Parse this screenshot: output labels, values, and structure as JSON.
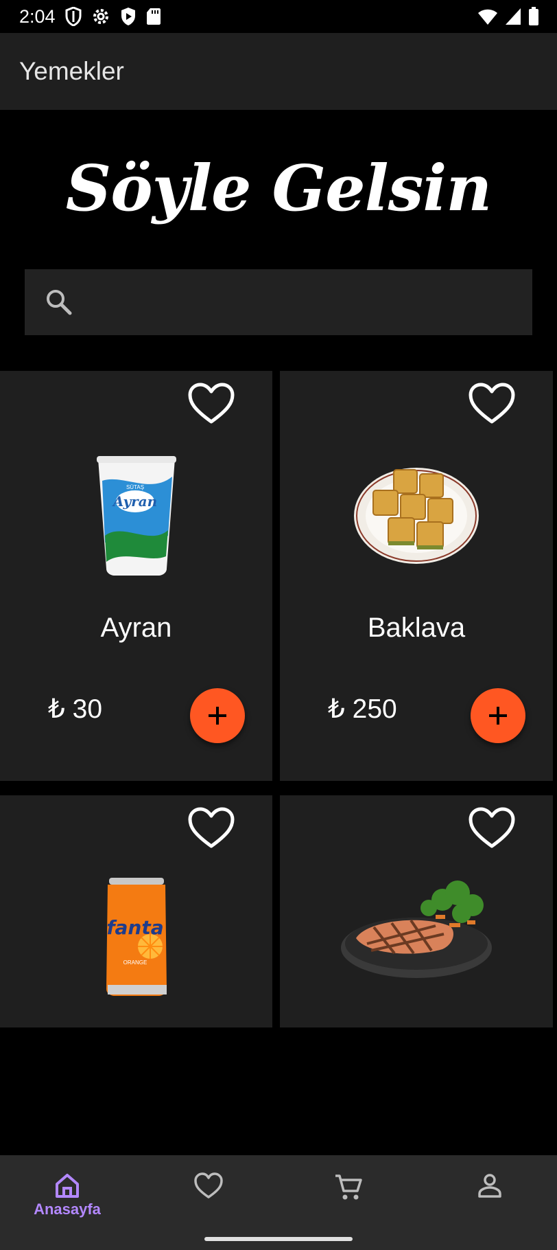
{
  "status_bar": {
    "time": "2:04"
  },
  "app_bar": {
    "title": "Yemekler"
  },
  "brand": {
    "title": "Söyle Gelsin"
  },
  "search": {
    "placeholder": ""
  },
  "products": [
    {
      "name": "Ayran",
      "price": "₺ 30",
      "image": "ayran-cup"
    },
    {
      "name": "Baklava",
      "price": "₺ 250",
      "image": "baklava-plate"
    },
    {
      "name": "",
      "price": "",
      "image": "fanta-can"
    },
    {
      "name": "",
      "price": "",
      "image": "salmon-plate"
    }
  ],
  "bottom_nav": {
    "items": [
      {
        "label": "Anasayfa",
        "icon": "home-icon",
        "active": true
      },
      {
        "label": "",
        "icon": "heart-icon",
        "active": false
      },
      {
        "label": "",
        "icon": "cart-icon",
        "active": false
      },
      {
        "label": "",
        "icon": "person-icon",
        "active": false
      }
    ]
  },
  "colors": {
    "accent": "#ff5722",
    "nav_active": "#b388ff",
    "card": "#1f1f1f",
    "background": "#000000"
  }
}
